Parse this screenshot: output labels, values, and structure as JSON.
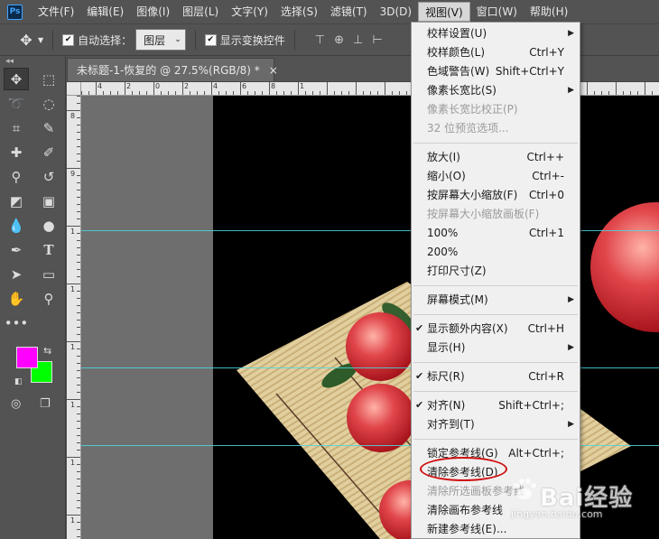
{
  "app": {
    "logo": "Ps"
  },
  "menubar": {
    "items": [
      {
        "label": "文件(F)"
      },
      {
        "label": "编辑(E)"
      },
      {
        "label": "图像(I)"
      },
      {
        "label": "图层(L)"
      },
      {
        "label": "文字(Y)"
      },
      {
        "label": "选择(S)"
      },
      {
        "label": "滤镜(T)"
      },
      {
        "label": "3D(D)"
      },
      {
        "label": "视图(V)",
        "active": true
      },
      {
        "label": "窗口(W)"
      },
      {
        "label": "帮助(H)"
      }
    ]
  },
  "options": {
    "auto_select_label": "自动选择：",
    "auto_select_checked": true,
    "auto_select_target": "图层",
    "show_transform_label": "显示变换控件",
    "show_transform_checked": true
  },
  "document": {
    "tab_title": "未标题-1-恢复的 @ 27.5%(RGB/8) *",
    "close_glyph": "×"
  },
  "rulers": {
    "horizontal_labels": [
      "4",
      "2",
      "0",
      "2",
      "4",
      "6",
      "8",
      "1"
    ],
    "vertical_labels": [
      "8",
      "9",
      "1",
      "1",
      "1",
      "1",
      "1",
      "1"
    ]
  },
  "swatches": {
    "foreground": "#ff00ff",
    "background": "#00ff00"
  },
  "view_menu": {
    "items": [
      {
        "label": "校样设置(U)",
        "submenu": true
      },
      {
        "label": "校样颜色(L)",
        "shortcut": "Ctrl+Y"
      },
      {
        "label": "色域警告(W)",
        "shortcut": "Shift+Ctrl+Y"
      },
      {
        "label": "像素长宽比(S)",
        "submenu": true
      },
      {
        "label": "像素长宽比校正(P)",
        "disabled": true
      },
      {
        "label": "32 位预览选项...",
        "disabled": true
      },
      {
        "separator": true
      },
      {
        "label": "放大(I)",
        "shortcut": "Ctrl++"
      },
      {
        "label": "缩小(O)",
        "shortcut": "Ctrl+-"
      },
      {
        "label": "按屏幕大小缩放(F)",
        "shortcut": "Ctrl+0"
      },
      {
        "label": "按屏幕大小缩放画板(F)",
        "disabled": true
      },
      {
        "label": "100%",
        "shortcut": "Ctrl+1"
      },
      {
        "label": "200%"
      },
      {
        "label": "打印尺寸(Z)"
      },
      {
        "separator": true
      },
      {
        "label": "屏幕模式(M)",
        "submenu": true
      },
      {
        "separator": true
      },
      {
        "label": "显示额外内容(X)",
        "shortcut": "Ctrl+H",
        "checked": true
      },
      {
        "label": "显示(H)",
        "submenu": true
      },
      {
        "separator": true
      },
      {
        "label": "标尺(R)",
        "shortcut": "Ctrl+R",
        "checked": true
      },
      {
        "separator": true
      },
      {
        "label": "对齐(N)",
        "shortcut": "Shift+Ctrl+;",
        "checked": true
      },
      {
        "label": "对齐到(T)",
        "submenu": true
      },
      {
        "separator": true
      },
      {
        "label": "锁定参考线(G)",
        "shortcut": "Alt+Ctrl+;"
      },
      {
        "label": "清除参考线(D)",
        "highlighted": true
      },
      {
        "label": "清除所选画板参考线",
        "disabled": true
      },
      {
        "label": "清除画布参考线"
      },
      {
        "label": "新建参考线(E)..."
      }
    ]
  },
  "watermark": {
    "brand": "Bai经验",
    "url": "jingyan.baidu.com"
  }
}
